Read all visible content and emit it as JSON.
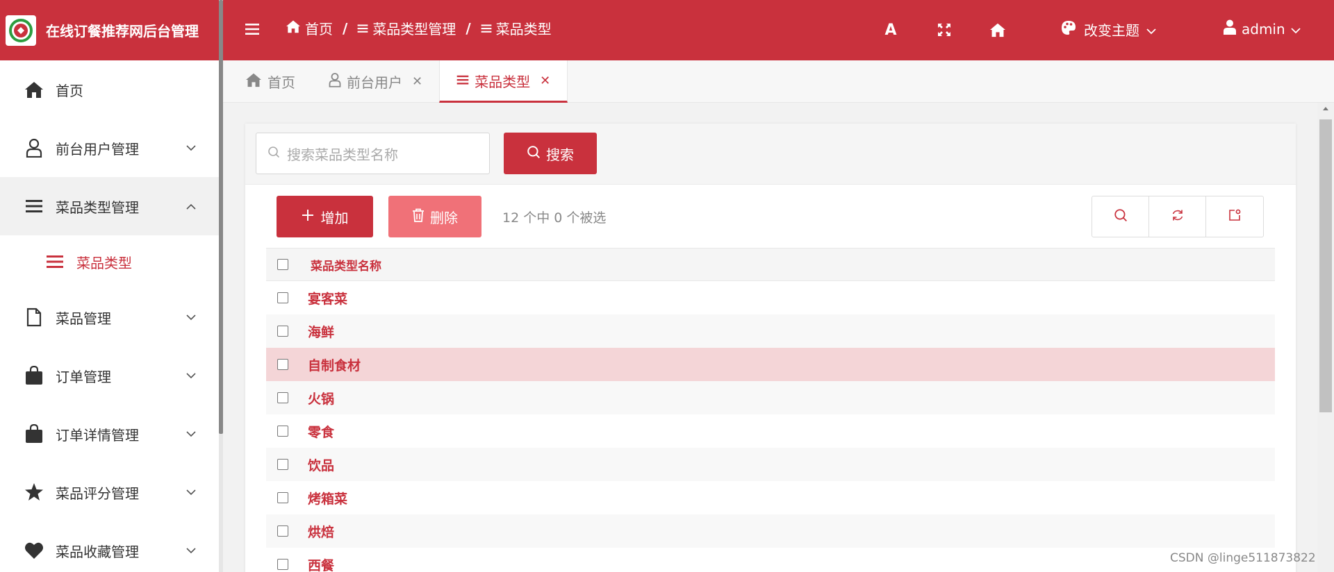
{
  "brand": {
    "title": "在线订餐推荐网后台管理"
  },
  "header": {
    "breadcrumbs": [
      "首页",
      "菜品类型管理",
      "菜品类型"
    ],
    "font_tool": "A",
    "theme_label": "改变主题",
    "user_label": "admin"
  },
  "sidebar": {
    "items": [
      {
        "label": "首页",
        "icon": "home-icon"
      },
      {
        "label": "前台用户管理",
        "icon": "user-icon"
      },
      {
        "label": "菜品类型管理",
        "icon": "list-icon"
      },
      {
        "label": "菜品管理",
        "icon": "file-icon"
      },
      {
        "label": "订单管理",
        "icon": "shopping-bag-icon"
      },
      {
        "label": "订单详情管理",
        "icon": "shopping-bag-icon"
      },
      {
        "label": "菜品评分管理",
        "icon": "star-icon"
      },
      {
        "label": "菜品收藏管理",
        "icon": "heart-icon"
      }
    ],
    "submenu": {
      "label": "菜品类型"
    }
  },
  "tabs": [
    {
      "label": "首页"
    },
    {
      "label": "前台用户"
    },
    {
      "label": "菜品类型"
    }
  ],
  "search": {
    "placeholder": "搜索菜品类型名称",
    "button_label": "搜索"
  },
  "actions": {
    "add_label": "增加",
    "delete_label": "删除",
    "selection_info": "12 个中 0 个被选"
  },
  "table": {
    "header": "菜品类型名称",
    "rows": [
      "宴客菜",
      "海鲜",
      "自制食材",
      "火锅",
      "零食",
      "饮品",
      "烤箱菜",
      "烘焙",
      "西餐"
    ]
  },
  "watermark": "CSDN @linge511873822",
  "colors": {
    "accent": "#c9313d",
    "delete": "#f07178",
    "highlight_row": "#f4d5d7"
  }
}
